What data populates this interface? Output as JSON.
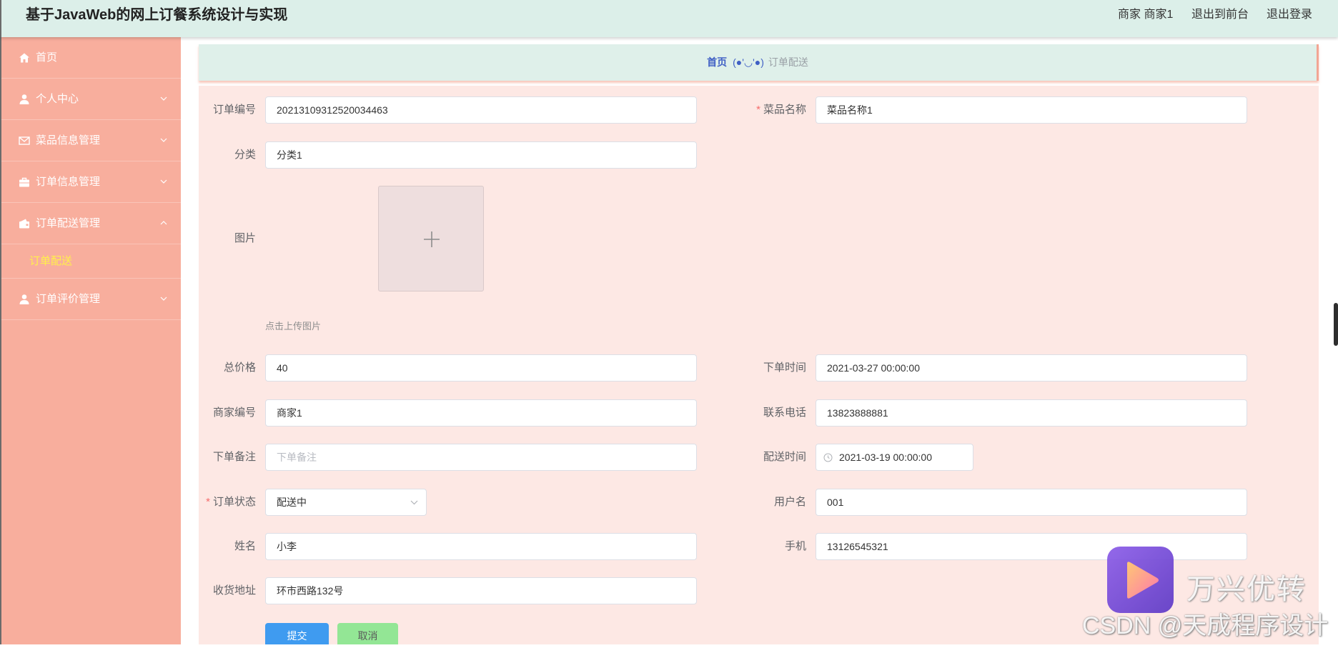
{
  "app": {
    "title": "基于JavaWeb的网上订餐系统设计与实现"
  },
  "header": {
    "user_label": "商家 商家1",
    "to_front": "退出到前台",
    "logout": "退出登录"
  },
  "sidebar": {
    "items": [
      {
        "label": "首页",
        "icon": "home-icon"
      },
      {
        "label": "个人中心",
        "icon": "user-icon",
        "expanded": false
      },
      {
        "label": "菜品信息管理",
        "icon": "envelope-icon",
        "expanded": false
      },
      {
        "label": "订单信息管理",
        "icon": "briefcase-icon",
        "expanded": false
      },
      {
        "label": "订单配送管理",
        "icon": "wallet-icon",
        "expanded": true,
        "children": [
          {
            "label": "订单配送",
            "active": true
          }
        ]
      },
      {
        "label": "订单评价管理",
        "icon": "user-icon",
        "expanded": false
      }
    ]
  },
  "breadcrumb": {
    "home": "首页",
    "separator": "(●'◡'●)",
    "current": "订单配送"
  },
  "form": {
    "required_mark": "*",
    "order_no": {
      "label": "订单编号",
      "value": "20213109312520034463"
    },
    "dish_name": {
      "label": "菜品名称",
      "value": "菜品名称1",
      "required": true
    },
    "category": {
      "label": "分类",
      "value": "分类1"
    },
    "image": {
      "label": "图片",
      "hint": "点击上传图片",
      "icon": "plus-icon"
    },
    "total_price": {
      "label": "总价格",
      "value": "40"
    },
    "order_time": {
      "label": "下单时间",
      "value": "2021-03-27 00:00:00"
    },
    "merchant_no": {
      "label": "商家编号",
      "value": "商家1"
    },
    "contact_phone": {
      "label": "联系电话",
      "value": "13823888881"
    },
    "order_note": {
      "label": "下单备注",
      "value": "",
      "placeholder": "下单备注"
    },
    "delivery_time": {
      "label": "配送时间",
      "value": "2021-03-19 00:00:00",
      "icon": "clock-icon"
    },
    "order_status": {
      "label": "订单状态",
      "value": "配送中",
      "required": true
    },
    "username": {
      "label": "用户名",
      "value": "001"
    },
    "name": {
      "label": "姓名",
      "value": "小李"
    },
    "mobile": {
      "label": "手机",
      "value": "13126545321"
    },
    "address": {
      "label": "收货地址",
      "value": "环市西路132号"
    }
  },
  "buttons": {
    "submit": "提交",
    "cancel": "取消"
  },
  "watermark": {
    "brand": "万兴优转",
    "credit": "CSDN @天成程序设计"
  },
  "colors": {
    "header_bg": "#dcefe9",
    "sidebar_bg": "#f8ae9d",
    "panel_bg": "#fde8e4",
    "crumb_bg": "#dff0ea",
    "primary": "#3f9bf0",
    "cancel_bg": "#93e695",
    "sub_active": "#fff04a",
    "crumb_link": "#3f5fc4"
  }
}
